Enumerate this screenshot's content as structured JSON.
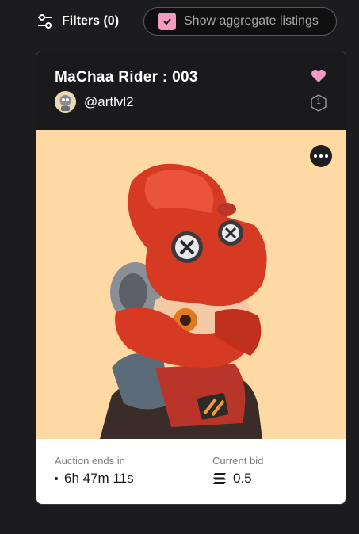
{
  "toolbar": {
    "filters_label": "Filters (0)",
    "aggregate_label": "Show aggregate listings",
    "aggregate_checked": true
  },
  "card": {
    "title": "MaChaa Rider : 003",
    "creator_handle": "@artlvl2",
    "edition": "1",
    "favorited": true,
    "auction": {
      "ends_label": "Auction ends in",
      "ends_value": "6h 47m 11s",
      "bid_label": "Current bid",
      "bid_value": "0.5",
      "currency_icon": "solana-icon"
    }
  },
  "colors": {
    "accent_pink": "#f49ac2",
    "art_background": "#ffd9a3",
    "page_background": "#1c1c1e"
  }
}
